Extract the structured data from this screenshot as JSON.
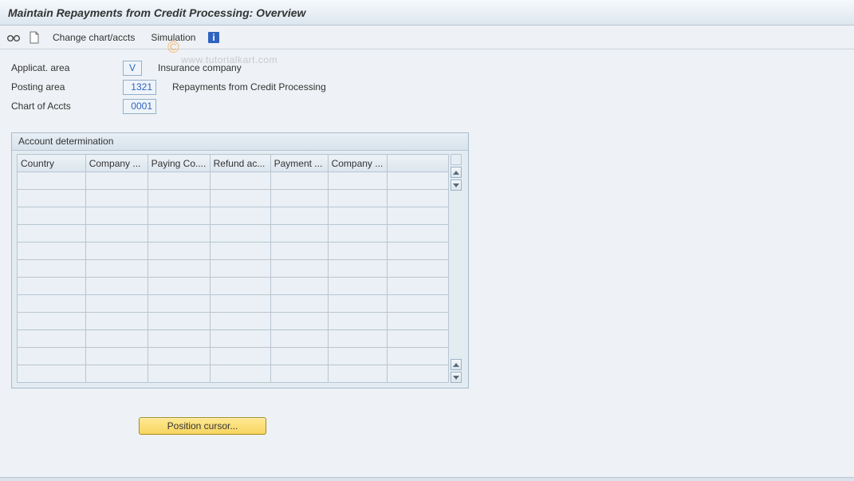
{
  "title": "Maintain Repayments from Credit Processing: Overview",
  "toolbar": {
    "change_btn": "Change chart/accts",
    "simulation_btn": "Simulation"
  },
  "fields": {
    "applicat_area": {
      "label": "Applicat. area",
      "value": "V",
      "desc": "Insurance company"
    },
    "posting_area": {
      "label": "Posting area",
      "value": "1321",
      "desc": "Repayments from Credit Processing"
    },
    "chart_accts": {
      "label": "Chart of Accts",
      "value": "0001",
      "desc": ""
    }
  },
  "group": {
    "title": "Account determination",
    "columns": [
      "Country",
      "Company ...",
      "Paying Co....",
      "Refund ac...",
      "Payment ...",
      "Company ..."
    ],
    "row_count": 12
  },
  "position_btn": "Position cursor...",
  "watermark": "www.tutorialkart.com"
}
